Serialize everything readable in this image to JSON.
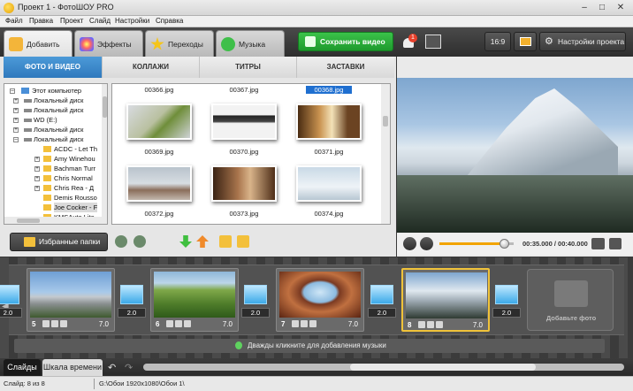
{
  "window": {
    "title": "Проект 1 - ФотоШОУ PRO",
    "minimize": "–",
    "maximize": "□",
    "close": "✕"
  },
  "menu": [
    "Файл",
    "Правка",
    "Проект",
    "Слайд",
    "Настройки",
    "Справка"
  ],
  "toolbar": {
    "tabs": [
      "Добавить",
      "Эффекты",
      "Переходы",
      "Музыка"
    ],
    "save_label": "Сохранить видео",
    "notification_count": "1",
    "aspect_label": "16:9",
    "settings_label": "Настройки проекта"
  },
  "subtabs": [
    "ФОТО И ВИДЕО",
    "КОЛЛАЖИ",
    "ТИТРЫ",
    "ЗАСТАВКИ"
  ],
  "tree": [
    "Этот компьютер",
    "Локальный диск",
    "Локальный диск",
    "WD (E:)",
    "Локальный диск",
    "Локальный диск",
    "ACDC - Let Th",
    "Amy Winehou",
    "Bachman Turr",
    "Chris Normal",
    "Chris Rea - Д",
    "Demis Rousso",
    "Joe Cocker - F",
    "KMSAuto Lite"
  ],
  "files": {
    "top_captions": [
      "00366.jpg",
      "00367.jpg",
      "00368.jpg"
    ],
    "rows": [
      [
        "00369.jpg",
        "00370.jpg",
        "00371.jpg"
      ],
      [
        "00372.jpg",
        "00373.jpg",
        "00374.jpg"
      ]
    ]
  },
  "favorites_label": "Избранные папки",
  "preview": {
    "timecode": "00:35.000 / 00:40.000",
    "progress": 0.875
  },
  "storyboard": {
    "slides": [
      {
        "num": "5",
        "dur": "7.0"
      },
      {
        "num": "6",
        "dur": "7.0"
      },
      {
        "num": "7",
        "dur": "7.0"
      },
      {
        "num": "8",
        "dur": "7.0"
      }
    ],
    "transitions": [
      "2.0",
      "2.0",
      "2.0",
      "2.0",
      "2.0"
    ],
    "add_photo_label": "Добавьте фото",
    "music_hint": "Дважды кликните для добавления музыки"
  },
  "bottom": {
    "tab_slides": "Слайды",
    "tab_timeline": "Шкала времени"
  },
  "status": {
    "slide_counter": "Слайд: 8 из 8",
    "path": "G:\\Обои 1920x1080\\Обои 1\\"
  },
  "colors": {
    "accent_blue": "#2f79bd",
    "save_green": "#1e9a2d",
    "active_gold": "#f0c33a"
  }
}
